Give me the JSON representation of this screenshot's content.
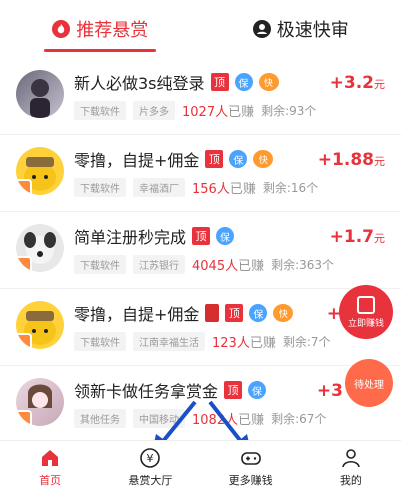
{
  "tabs": [
    {
      "label": "推荐悬赏",
      "icon": "fire-icon",
      "active": true
    },
    {
      "label": "极速快审",
      "icon": "user-circle-icon",
      "active": false
    }
  ],
  "tasks": [
    {
      "title": "新人必做3s纯登录",
      "price": "+3.2",
      "unit": "元",
      "tags": [
        "下载软件",
        "片多多"
      ],
      "count": "1027人",
      "count_suffix": "已赚",
      "remaining": "剩余:93个",
      "badges": [
        "顶",
        "保",
        "快"
      ]
    },
    {
      "title": "零撸，自提+佣金",
      "price": "+1.88",
      "unit": "元",
      "tags": [
        "下载软件",
        "幸福酒厂"
      ],
      "count": "156人",
      "count_suffix": "已赚",
      "remaining": "剩余:16个",
      "badges": [
        "顶",
        "保",
        "快"
      ]
    },
    {
      "title": "简单注册秒完成",
      "price": "+1.7",
      "unit": "元",
      "tags": [
        "下载软件",
        "江苏银行"
      ],
      "count": "4045人",
      "count_suffix": "已赚",
      "remaining": "剩余:363个",
      "badges": [
        "顶",
        "保"
      ]
    },
    {
      "title": "零撸，自提+佣金",
      "price": "+",
      "unit": "",
      "tags": [
        "下载软件",
        "江南幸福生活"
      ],
      "count": "123人",
      "count_suffix": "已赚",
      "remaining": "剩余:7个",
      "badges": [
        "红包",
        "顶",
        "保",
        "快"
      ]
    },
    {
      "title": "领新卡做任务拿赏金",
      "price": "+3",
      "unit": "",
      "tags": [
        "其他任务",
        "中国移动"
      ],
      "count": "1082人",
      "count_suffix": "已赚",
      "remaining": "剩余:67个",
      "badges": [
        "顶",
        "保"
      ]
    }
  ],
  "floats": {
    "earn_label": "立即赚钱",
    "pending_label": "待处理"
  },
  "nav": [
    {
      "label": "首页",
      "icon": "home-icon",
      "active": true
    },
    {
      "label": "悬赏大厅",
      "icon": "yuan-coin-icon",
      "active": false
    },
    {
      "label": "更多赚钱",
      "icon": "gamepad-icon",
      "active": false
    },
    {
      "label": "我的",
      "icon": "person-icon",
      "active": false
    }
  ],
  "colors": {
    "accent": "#e8323c",
    "guarantee": "#4aa3ff",
    "fast": "#ff9a2e",
    "arrow": "#1a4fc7"
  }
}
